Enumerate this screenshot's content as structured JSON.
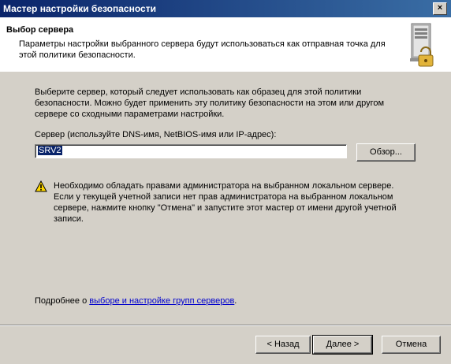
{
  "window": {
    "title": "Мастер настройки безопасности",
    "close_glyph": "×",
    "accent_color": "#0a246a"
  },
  "header": {
    "title": "Выбор сервера",
    "description": "Параметры настройки выбранного сервера будут использоваться как отправная точка для этой политики безопасности.",
    "icon": "server-lock-icon"
  },
  "main": {
    "intro": "Выберите сервер, который следует использовать как образец для этой политики безопасности. Можно будет применить эту политику безопасности на этом или другом сервере со сходными параметрами настройки.",
    "field_label": "Сервер (используйте DNS-имя, NetBIOS-имя или IP-адрес):",
    "server_value": "SRV2",
    "browse_label": "Обзор...",
    "warning_icon": "warning-icon",
    "warning_text": "Необходимо обладать правами администратора на выбранном локальном сервере. Если у текущей учетной записи нет прав администратора на выбранном локальном сервере, нажмите кнопку \"Отмена\" и запустите этот мастер от имени другой учетной записи.",
    "more_prefix": "Подробнее о ",
    "more_link": "выборе и настройке групп серверов",
    "more_suffix": "."
  },
  "footer": {
    "back_label": "< Назад",
    "next_label": "Далее >",
    "cancel_label": "Отмена"
  }
}
